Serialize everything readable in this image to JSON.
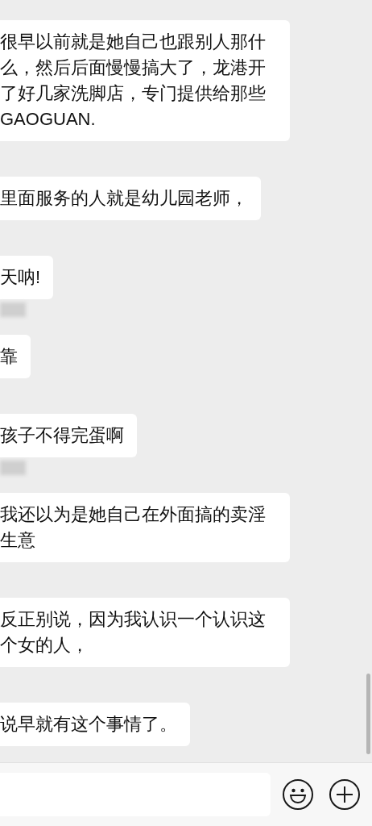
{
  "messages": [
    {
      "text": "很早以前就是她自己也跟别人那什么，然后后面慢慢搞大了，龙港开了好几家洗脚店，专门提供给那些GAOGUAN.",
      "name_blurred": false
    },
    {
      "text": "里面服务的人就是幼儿园老师，",
      "name_blurred": false
    },
    {
      "text": "天呐!",
      "name_blurred": false
    },
    {
      "text": "靠",
      "name_blurred": true
    },
    {
      "text": "孩子不得完蛋啊",
      "name_blurred": false
    },
    {
      "text": "我还以为是她自己在外面搞的卖淫生意",
      "name_blurred": true
    },
    {
      "text": "反正别说，因为我认识一个认识这个女的人，",
      "name_blurred": false
    },
    {
      "text": "说早就有这个事情了。",
      "name_blurred": false
    }
  ]
}
